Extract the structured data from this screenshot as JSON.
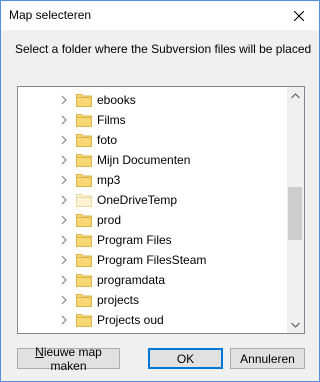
{
  "window": {
    "title": "Map selecteren",
    "instruction": "Select a folder where the Subversion files will be placed"
  },
  "tree": {
    "items": [
      {
        "label": "ebooks",
        "icon": "folder-icon",
        "selected_style": false
      },
      {
        "label": "Films",
        "icon": "folder-icon"
      },
      {
        "label": "foto",
        "icon": "folder-icon"
      },
      {
        "label": "Mijn Documenten",
        "icon": "folder-icon"
      },
      {
        "label": "mp3",
        "icon": "folder-icon"
      },
      {
        "label": "OneDriveTemp",
        "icon": "folder-icon-light"
      },
      {
        "label": "prod",
        "icon": "folder-icon"
      },
      {
        "label": "Program Files",
        "icon": "folder-icon"
      },
      {
        "label": "Program FilesSteam",
        "icon": "folder-icon"
      },
      {
        "label": "programdata",
        "icon": "folder-icon"
      },
      {
        "label": "projects",
        "icon": "folder-icon"
      },
      {
        "label": "Projects oud",
        "icon": "folder-icon"
      }
    ],
    "scroll_fraction": 0.58
  },
  "buttons": {
    "new_folder": "Nieuwe map maken",
    "ok": "OK",
    "cancel": "Annuleren"
  },
  "colors": {
    "folder": "#f8d775",
    "folder_light": "#fdf2cf",
    "accent": "#0078d7"
  }
}
